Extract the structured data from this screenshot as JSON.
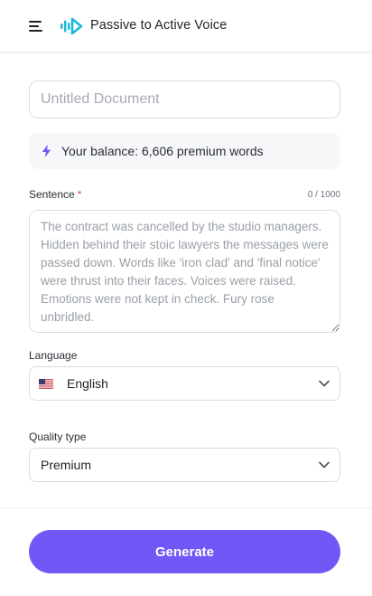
{
  "header": {
    "title": "Passive to Active Voice",
    "menu_icon": "hamburger-menu-icon",
    "logo_icon": "voice-logo-icon",
    "logo_color": "#18b8d8"
  },
  "form": {
    "document_title": {
      "placeholder": "Untitled Document",
      "value": ""
    },
    "balance": {
      "icon": "lightning-bolt-icon",
      "text": "Your balance: 6,606 premium words"
    },
    "sentence": {
      "label": "Sentence",
      "required_marker": "*",
      "counter": "0 / 1000",
      "value": "",
      "placeholder": "The contract was cancelled by the studio managers. Hidden behind their stoic lawyers the messages were passed down. Words like 'iron clad' and 'final notice' were thrust into their faces. Voices were raised. Emotions were not kept in check. Fury rose unbridled."
    },
    "language": {
      "label": "Language",
      "selected": "English",
      "flag_icon": "us-flag-icon"
    },
    "quality": {
      "label": "Quality type",
      "selected": "Premium"
    },
    "generate_label": "Generate"
  },
  "colors": {
    "accent": "#7357f6",
    "required": "#e5484d",
    "border": "#d9dce1",
    "balance_bg": "#f6f7f9"
  }
}
